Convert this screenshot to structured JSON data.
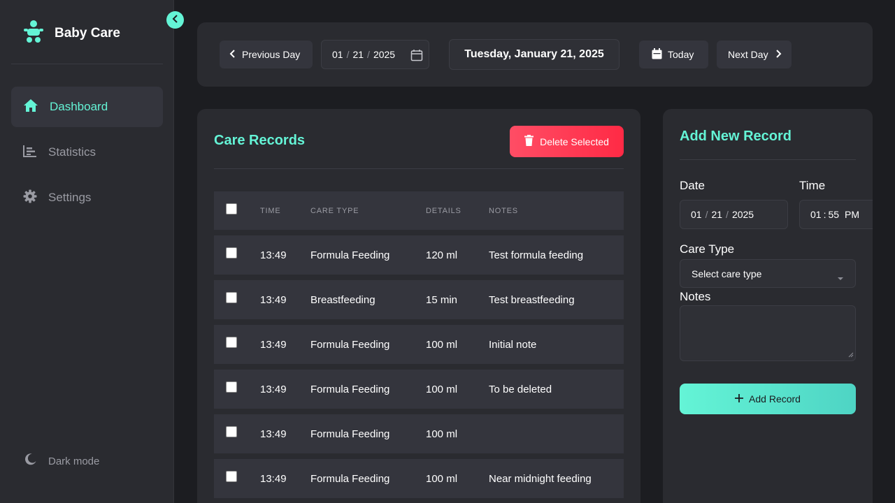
{
  "app": {
    "title": "Baby Care"
  },
  "sidebar": {
    "items": [
      {
        "label": "Dashboard",
        "icon": "home-icon",
        "active": true
      },
      {
        "label": "Statistics",
        "icon": "bar-chart-icon",
        "active": false
      },
      {
        "label": "Settings",
        "icon": "gear-icon",
        "active": false
      }
    ],
    "dark_mode_label": "Dark mode"
  },
  "datebar": {
    "prev_label": "Previous Day",
    "date_month": "01",
    "date_day": "21",
    "date_year": "2025",
    "current_date": "Tuesday, January 21, 2025",
    "today_label": "Today",
    "next_label": "Next Day"
  },
  "records": {
    "title": "Care Records",
    "delete_label": "Delete Selected",
    "columns": {
      "time": "TIME",
      "type": "CARE TYPE",
      "details": "DETAILS",
      "notes": "NOTES"
    },
    "rows": [
      {
        "time": "13:49",
        "type": "Formula Feeding",
        "details": "120 ml",
        "notes": "Test formula feeding"
      },
      {
        "time": "13:49",
        "type": "Breastfeeding",
        "details": "15 min",
        "notes": "Test breastfeeding"
      },
      {
        "time": "13:49",
        "type": "Formula Feeding",
        "details": "100 ml",
        "notes": "Initial note"
      },
      {
        "time": "13:49",
        "type": "Formula Feeding",
        "details": "100 ml",
        "notes": "To be deleted"
      },
      {
        "time": "13:49",
        "type": "Formula Feeding",
        "details": "100 ml",
        "notes": ""
      },
      {
        "time": "13:49",
        "type": "Formula Feeding",
        "details": "100 ml",
        "notes": "Near midnight feeding"
      }
    ]
  },
  "form": {
    "title": "Add New Record",
    "date_label": "Date",
    "date_month": "01",
    "date_day": "21",
    "date_year": "2025",
    "time_label": "Time",
    "time_hour": "01",
    "time_minute": "55",
    "time_period": "PM",
    "care_type_label": "Care Type",
    "care_type_value": "Select care type",
    "notes_label": "Notes",
    "notes_value": "",
    "add_label": "Add Record"
  },
  "colors": {
    "accent": "#64f4d6",
    "danger": "#ff3b55",
    "background": "#1c1d21",
    "card": "#2a2b30"
  }
}
